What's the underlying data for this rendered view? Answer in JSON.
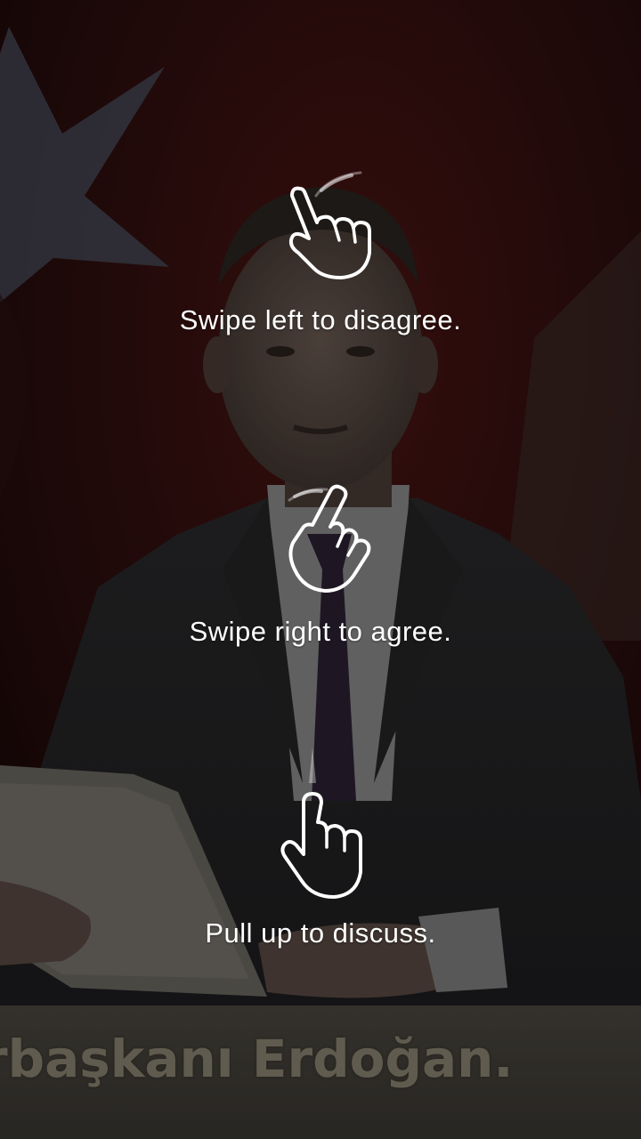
{
  "background": {
    "description_icon": "video-frame-icon",
    "subtitle": "rbaşkanı Erdoğan."
  },
  "onboarding": {
    "swipe_left": {
      "label": "Swipe left to disagree.",
      "icon": "swipe-left-hand-icon"
    },
    "swipe_right": {
      "label": "Swipe right to agree.",
      "icon": "swipe-right-hand-icon"
    },
    "pull_up": {
      "label": "Pull up to discuss.",
      "icon": "pull-up-hand-icon"
    }
  },
  "colors": {
    "overlay_text": "#ffffff",
    "flag_red": "#5a1414",
    "flag_star": "#4c4f5a"
  }
}
